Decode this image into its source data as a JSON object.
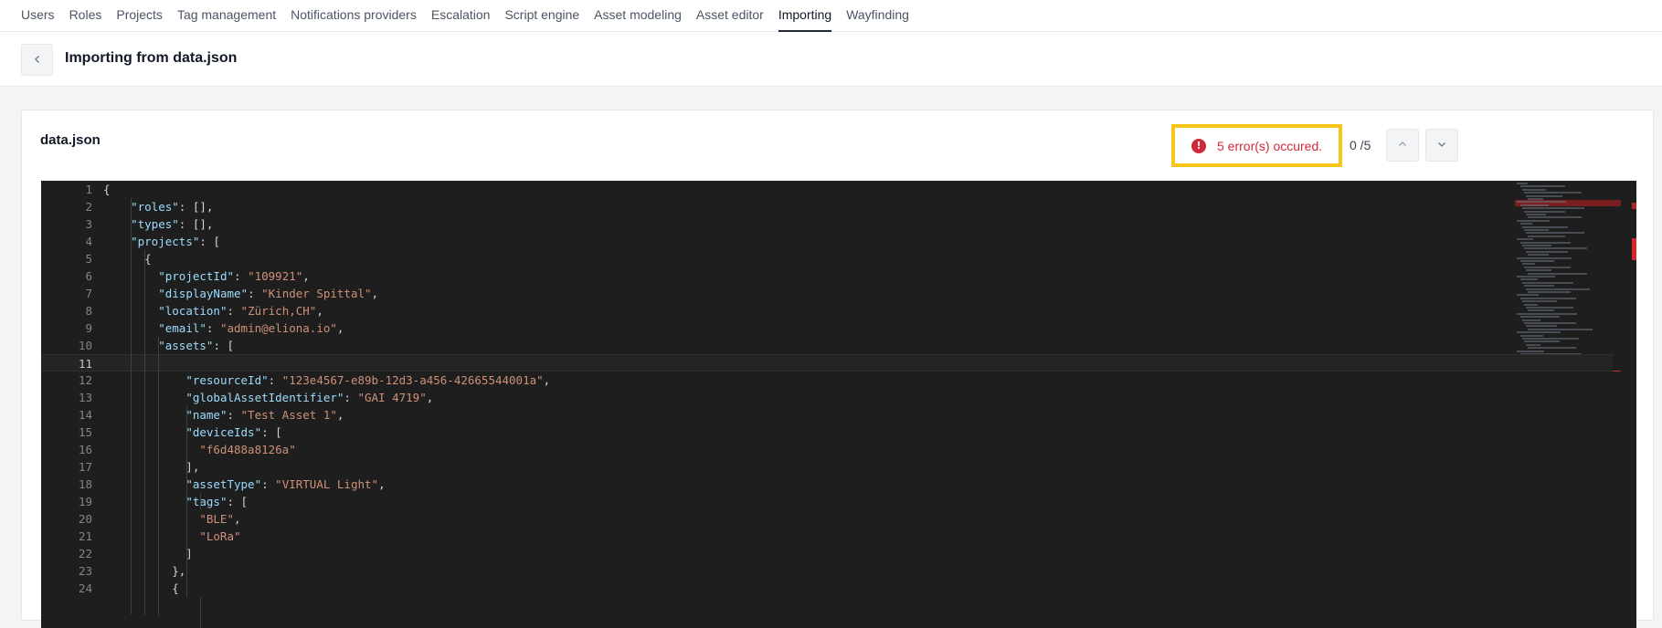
{
  "nav": {
    "tabs": [
      {
        "label": "Users"
      },
      {
        "label": "Roles"
      },
      {
        "label": "Projects"
      },
      {
        "label": "Tag management"
      },
      {
        "label": "Notifications providers"
      },
      {
        "label": "Escalation"
      },
      {
        "label": "Script engine"
      },
      {
        "label": "Asset modeling"
      },
      {
        "label": "Asset editor"
      },
      {
        "label": "Importing"
      },
      {
        "label": "Wayfinding"
      }
    ],
    "active": "Importing"
  },
  "header": {
    "back_icon": "chevron-left-icon",
    "title": "Importing from data.json"
  },
  "card": {
    "title": "data.json",
    "errors": {
      "icon": "error-icon",
      "icon_glyph": "!",
      "message": "5 error(s) occured.",
      "counter": "0 /5",
      "prev_icon": "chevron-up-icon",
      "next_icon": "chevron-down-icon",
      "color": "#d1283c",
      "highlight_color": "#f5c518"
    }
  },
  "editor": {
    "current_line": 11,
    "lines": [
      {
        "n": "1",
        "text": "{"
      },
      {
        "n": "2",
        "text": "    \"roles\": [],"
      },
      {
        "n": "3",
        "text": "    \"types\": [],"
      },
      {
        "n": "4",
        "text": "    \"projects\": ["
      },
      {
        "n": "5",
        "text": "      {"
      },
      {
        "n": "6",
        "text": "        \"projectId\": \"109921\","
      },
      {
        "n": "7",
        "text": "        \"displayName\": \"Kinder Spittal\","
      },
      {
        "n": "8",
        "text": "        \"location\": \"Zürich,CH\","
      },
      {
        "n": "9",
        "text": "        \"email\": \"admin@eliona.io\","
      },
      {
        "n": "10",
        "text": "        \"assets\": ["
      },
      {
        "n": "11",
        "text": ""
      },
      {
        "n": "12",
        "text": "            \"resourceId\": \"123e4567-e89b-12d3-a456-42665544001a\","
      },
      {
        "n": "13",
        "text": "            \"globalAssetIdentifier\": \"GAI 4719\","
      },
      {
        "n": "14",
        "text": "            \"name\": \"Test Asset 1\","
      },
      {
        "n": "15",
        "text": "            \"deviceIds\": ["
      },
      {
        "n": "16",
        "text": "              \"f6d488a8126a\""
      },
      {
        "n": "17",
        "text": "            ],"
      },
      {
        "n": "18",
        "text": "            \"assetType\": \"VIRTUAL Light\","
      },
      {
        "n": "19",
        "text": "            \"tags\": ["
      },
      {
        "n": "20",
        "text": "              \"BLE\","
      },
      {
        "n": "21",
        "text": "              \"LoRa\""
      },
      {
        "n": "22",
        "text": "            ]"
      },
      {
        "n": "23",
        "text": "          },"
      },
      {
        "n": "24",
        "text": "          {"
      }
    ]
  }
}
